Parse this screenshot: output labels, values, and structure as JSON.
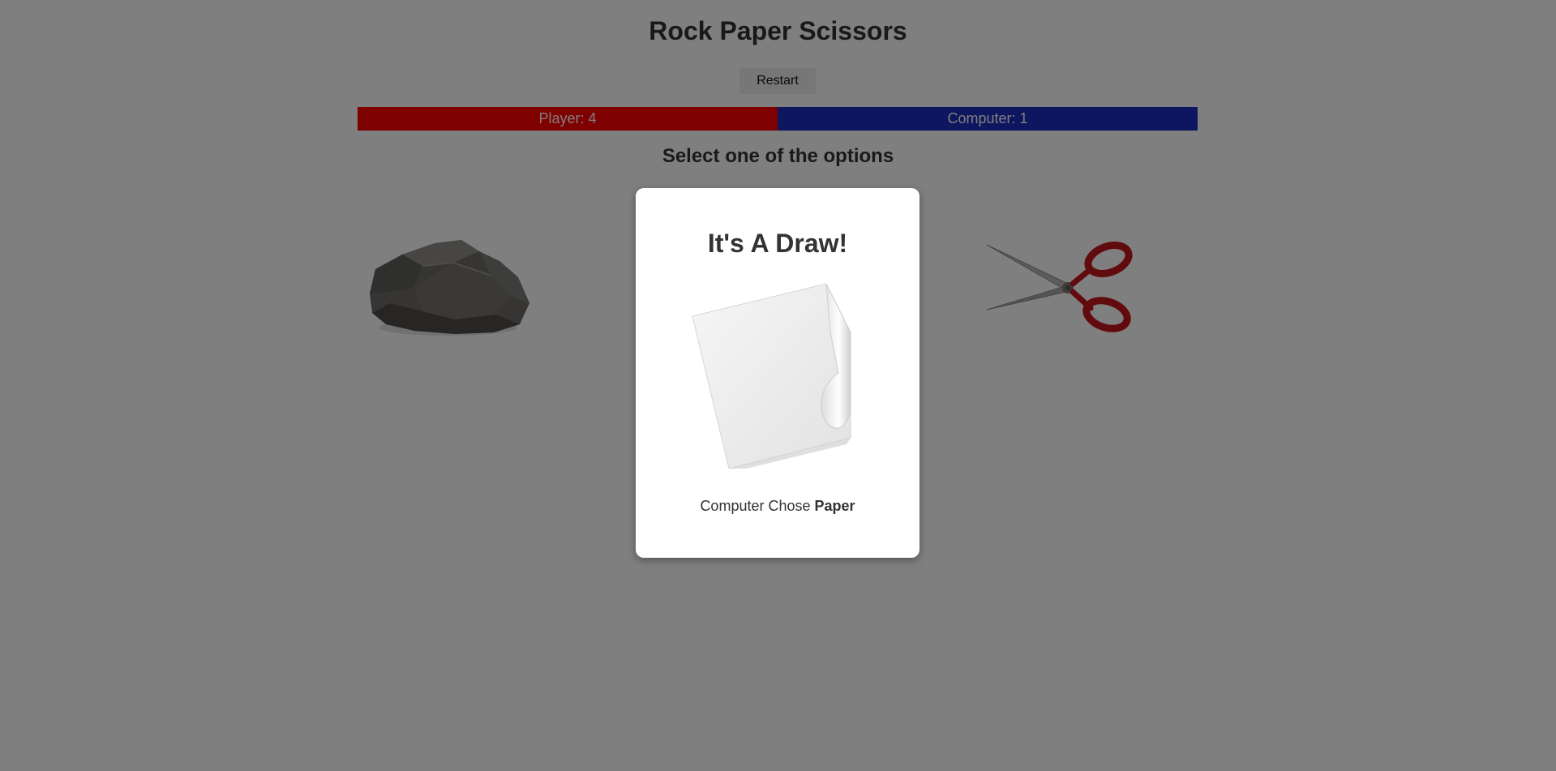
{
  "header": {
    "title": "Rock Paper Scissors",
    "restart_label": "Restart"
  },
  "scoreboard": {
    "player_label": "Player: 4",
    "computer_label": "Computer: 1",
    "player_score": 4,
    "computer_score": 1,
    "player_color": "#ff0000",
    "computer_color": "#1a2cbf"
  },
  "prompt": "Select one of the options",
  "choices": [
    {
      "name": "rock",
      "icon": "rock-image"
    },
    {
      "name": "paper",
      "icon": "paper-image"
    },
    {
      "name": "scissors",
      "icon": "scissors-image"
    }
  ],
  "result_modal": {
    "visible": true,
    "title": "It's A Draw!",
    "icon": "paper-image",
    "text_prefix": "Computer Chose",
    "choice": "Paper"
  },
  "colors": {
    "overlay": "rgba(0,0,0,0.5)",
    "scissor_handles": "#c4161c"
  }
}
